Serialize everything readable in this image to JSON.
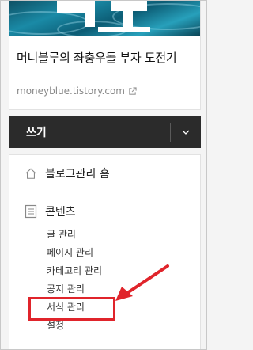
{
  "blog": {
    "title": "머니블루의 좌충우돌 부자 도전기",
    "url": "moneyblue.tistory.com"
  },
  "write_bar": {
    "label": "쓰기"
  },
  "menu": {
    "home_label": "블로그관리 홈",
    "contents_label": "콘텐츠",
    "sub_items": [
      "글 관리",
      "페이지 관리",
      "카테고리 관리",
      "공지 관리",
      "서식 관리",
      "설정"
    ]
  },
  "annotation": {
    "color": "#e0242b",
    "highlighted_item": "서식 관리"
  },
  "icons": [
    "external-link-icon",
    "chevron-down-icon",
    "home-icon",
    "document-icon"
  ]
}
